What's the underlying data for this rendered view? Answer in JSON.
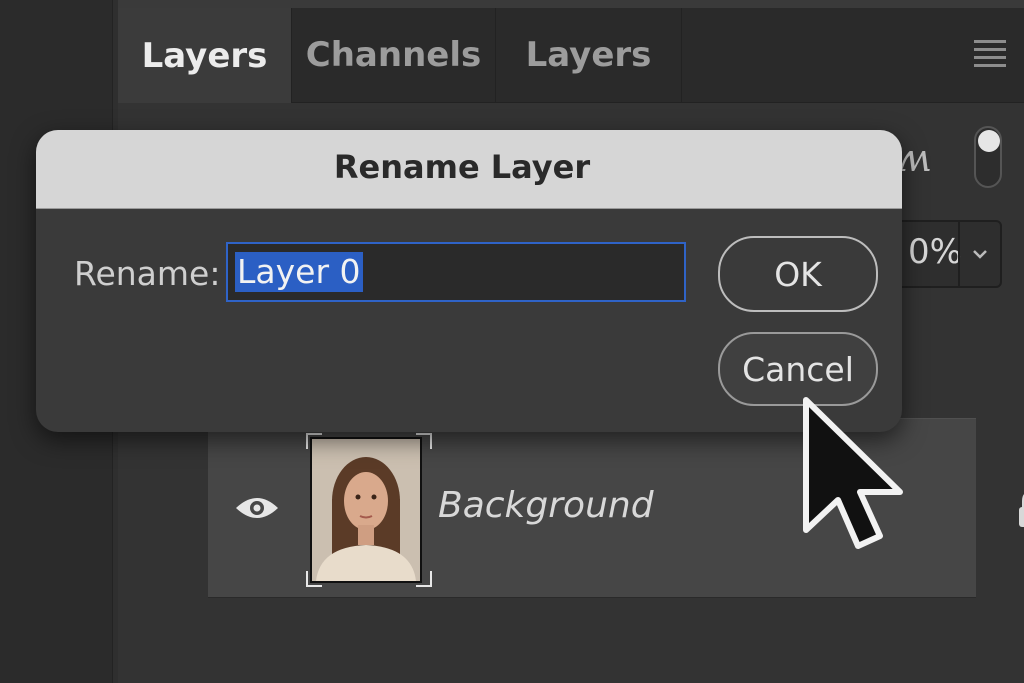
{
  "tabs": [
    {
      "label": "Layers",
      "active": true
    },
    {
      "label": "Channels",
      "active": false
    },
    {
      "label": "Layers",
      "active": false
    }
  ],
  "panel_menu_icon": "hamburger-menu-icon",
  "opacity": {
    "value": "0%"
  },
  "layer": {
    "name": "Background",
    "visible": true,
    "locked": true
  },
  "dialog": {
    "title": "Rename Layer",
    "field_label": "Rename:",
    "field_value": "Layer 0",
    "ok_label": "OK",
    "cancel_label": "Cancel"
  },
  "colors": {
    "selection": "#2b5fc4",
    "focus_ring": "#2f63c7",
    "titlebar": "#d6d6d6"
  }
}
